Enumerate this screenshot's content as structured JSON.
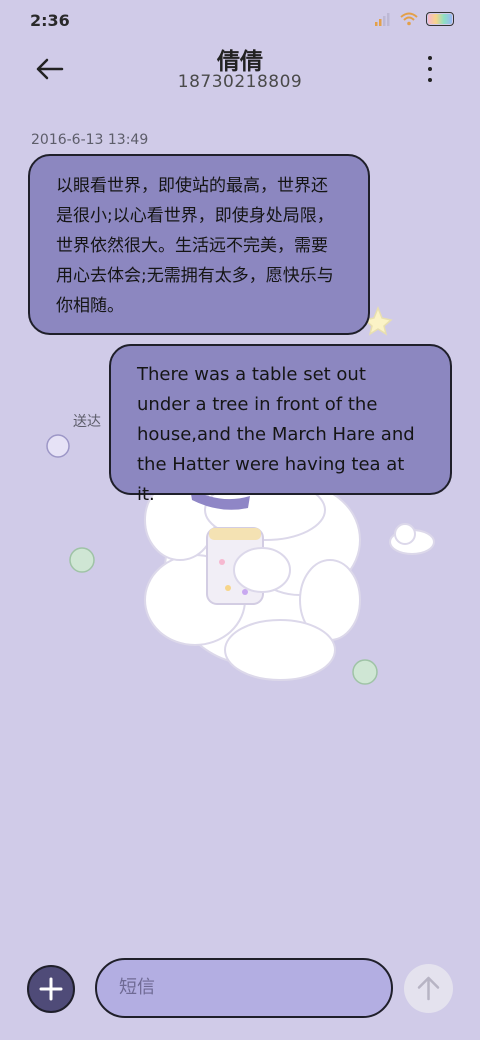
{
  "status_bar": {
    "time": "2:36",
    "icons": [
      "signal-icon",
      "wifi-icon",
      "battery-icon"
    ]
  },
  "header": {
    "contact_name": "倩倩",
    "contact_number": "18730218809"
  },
  "conversation": {
    "timestamp": "2016-6-13 13:49",
    "received_message": "以眼看世界，即使站的最高，世界还是很小;以心看世界，即使身处局限，世界依然很大。生活远不完美，需要用心去体会;无需拥有太多，愿快乐与你相随。",
    "sent_message": "There was a table set out under a tree in front of the house,and the March Hare and the Hatter were having tea at it.",
    "sent_status": "送达"
  },
  "composer": {
    "placeholder": "短信"
  },
  "colors": {
    "background": "#d0cbe8",
    "bubble": "#8c87c0",
    "input": "#b3aee2",
    "attach_button": "#4f4b78"
  }
}
